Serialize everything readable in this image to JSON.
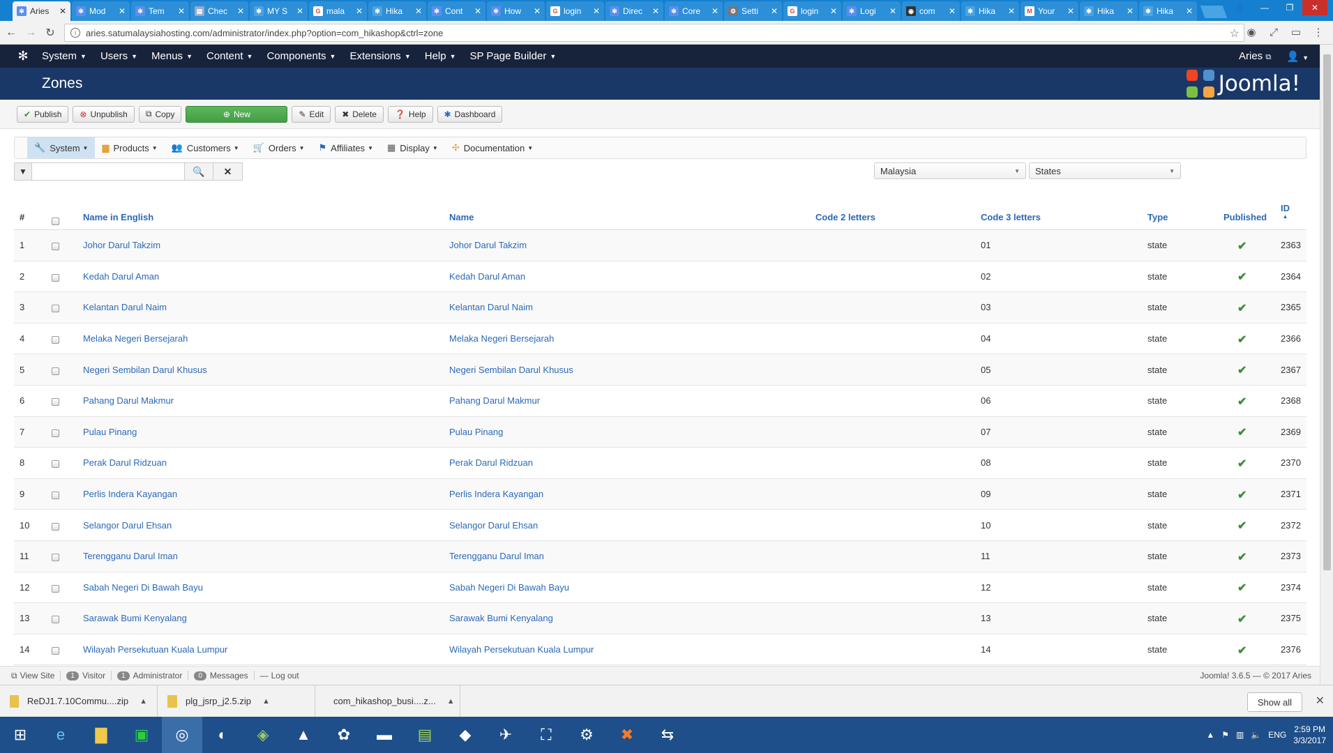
{
  "browser": {
    "tabs": [
      {
        "title": "Aries",
        "active": true,
        "icon": "joomla-icon"
      },
      {
        "title": "Mod",
        "icon": "joomla-icon"
      },
      {
        "title": "Tem",
        "icon": "joomla-icon"
      },
      {
        "title": "Chec",
        "icon": "page-icon"
      },
      {
        "title": "MY S",
        "icon": "hikashop-icon"
      },
      {
        "title": "mala",
        "icon": "google-icon"
      },
      {
        "title": "Hika",
        "icon": "hikashop-icon"
      },
      {
        "title": "Cont",
        "icon": "joomla-icon"
      },
      {
        "title": "How",
        "icon": "joomla-icon"
      },
      {
        "title": "login",
        "icon": "google-icon"
      },
      {
        "title": "Direc",
        "icon": "joomla-icon"
      },
      {
        "title": "Core",
        "icon": "joomla-icon"
      },
      {
        "title": "Setti",
        "icon": "gear-icon"
      },
      {
        "title": "login",
        "icon": "google-icon"
      },
      {
        "title": "Logi",
        "icon": "joomla-icon"
      },
      {
        "title": "com",
        "icon": "github-icon"
      },
      {
        "title": "Hika",
        "icon": "hikashop-icon"
      },
      {
        "title": "Your",
        "icon": "gmail-icon"
      },
      {
        "title": "Hika",
        "icon": "hikashop-icon"
      },
      {
        "title": "Hika",
        "icon": "hikashop-icon"
      }
    ],
    "url": "aries.satumalaysiahosting.com/administrator/index.php?option=com_hikashop&ctrl=zone"
  },
  "topnav": {
    "items": [
      "System",
      "Users",
      "Menus",
      "Content",
      "Components",
      "Extensions",
      "Help",
      "SP Page Builder"
    ],
    "site_name": "Aries"
  },
  "header": {
    "title": "Zones",
    "brand": "Joomla!"
  },
  "toolbar": {
    "publish": "Publish",
    "unpublish": "Unpublish",
    "copy": "Copy",
    "new": "New",
    "edit": "Edit",
    "delete": "Delete",
    "help": "Help",
    "dashboard": "Dashboard"
  },
  "subnav": [
    "System",
    "Products",
    "Customers",
    "Orders",
    "Affiliates",
    "Display",
    "Documentation"
  ],
  "filters": {
    "search_value": "",
    "country": "Malaysia",
    "zone_type": "States"
  },
  "table": {
    "headers": {
      "num": "#",
      "name_en": "Name in English",
      "name": "Name",
      "code2": "Code 2 letters",
      "code3": "Code 3 letters",
      "type": "Type",
      "published": "Published",
      "id": "ID"
    },
    "rows": [
      {
        "n": "1",
        "name_en": "Johor Darul Takzim",
        "name": "Johor Darul Takzim",
        "code2": "",
        "code3": "01",
        "type": "state",
        "id": "2363"
      },
      {
        "n": "2",
        "name_en": "Kedah Darul Aman",
        "name": "Kedah Darul Aman",
        "code2": "",
        "code3": "02",
        "type": "state",
        "id": "2364"
      },
      {
        "n": "3",
        "name_en": "Kelantan Darul Naim",
        "name": "Kelantan Darul Naim",
        "code2": "",
        "code3": "03",
        "type": "state",
        "id": "2365"
      },
      {
        "n": "4",
        "name_en": "Melaka Negeri Bersejarah",
        "name": "Melaka Negeri Bersejarah",
        "code2": "",
        "code3": "04",
        "type": "state",
        "id": "2366"
      },
      {
        "n": "5",
        "name_en": "Negeri Sembilan Darul Khusus",
        "name": "Negeri Sembilan Darul Khusus",
        "code2": "",
        "code3": "05",
        "type": "state",
        "id": "2367"
      },
      {
        "n": "6",
        "name_en": "Pahang Darul Makmur",
        "name": "Pahang Darul Makmur",
        "code2": "",
        "code3": "06",
        "type": "state",
        "id": "2368"
      },
      {
        "n": "7",
        "name_en": "Pulau Pinang",
        "name": "Pulau Pinang",
        "code2": "",
        "code3": "07",
        "type": "state",
        "id": "2369"
      },
      {
        "n": "8",
        "name_en": "Perak Darul Ridzuan",
        "name": "Perak Darul Ridzuan",
        "code2": "",
        "code3": "08",
        "type": "state",
        "id": "2370"
      },
      {
        "n": "9",
        "name_en": "Perlis Indera Kayangan",
        "name": "Perlis Indera Kayangan",
        "code2": "",
        "code3": "09",
        "type": "state",
        "id": "2371"
      },
      {
        "n": "10",
        "name_en": "Selangor Darul Ehsan",
        "name": "Selangor Darul Ehsan",
        "code2": "",
        "code3": "10",
        "type": "state",
        "id": "2372"
      },
      {
        "n": "11",
        "name_en": "Terengganu Darul Iman",
        "name": "Terengganu Darul Iman",
        "code2": "",
        "code3": "11",
        "type": "state",
        "id": "2373"
      },
      {
        "n": "12",
        "name_en": "Sabah Negeri Di Bawah Bayu",
        "name": "Sabah Negeri Di Bawah Bayu",
        "code2": "",
        "code3": "12",
        "type": "state",
        "id": "2374"
      },
      {
        "n": "13",
        "name_en": "Sarawak Bumi Kenyalang",
        "name": "Sarawak Bumi Kenyalang",
        "code2": "",
        "code3": "13",
        "type": "state",
        "id": "2375"
      },
      {
        "n": "14",
        "name_en": "Wilayah Persekutuan Kuala Lumpur",
        "name": "Wilayah Persekutuan Kuala Lumpur",
        "code2": "",
        "code3": "14",
        "type": "state",
        "id": "2376"
      }
    ]
  },
  "statusbar": {
    "view_site": "View Site",
    "visitor_count": "1",
    "visitor_label": "Visitor",
    "admin_count": "1",
    "admin_label": "Administrator",
    "messages_count": "0",
    "messages_label": "Messages",
    "logout": "Log out",
    "version": "Joomla! 3.6.5 — © 2017 Aries"
  },
  "downloads": {
    "items": [
      "ReDJ1.7.10Commu....zip",
      "plg_jsrp_j2.5.zip",
      "com_hikashop_busi....z..."
    ],
    "show_all": "Show all"
  },
  "taskbar": {
    "language": "ENG",
    "time": "2:59 PM",
    "date": "3/3/2017"
  },
  "colors": {
    "topnav_bg": "#17223b",
    "header_bg": "#1a3867",
    "link": "#2a69b8",
    "new_button": "#5cb85c",
    "published_check": "#3c8d3c"
  }
}
